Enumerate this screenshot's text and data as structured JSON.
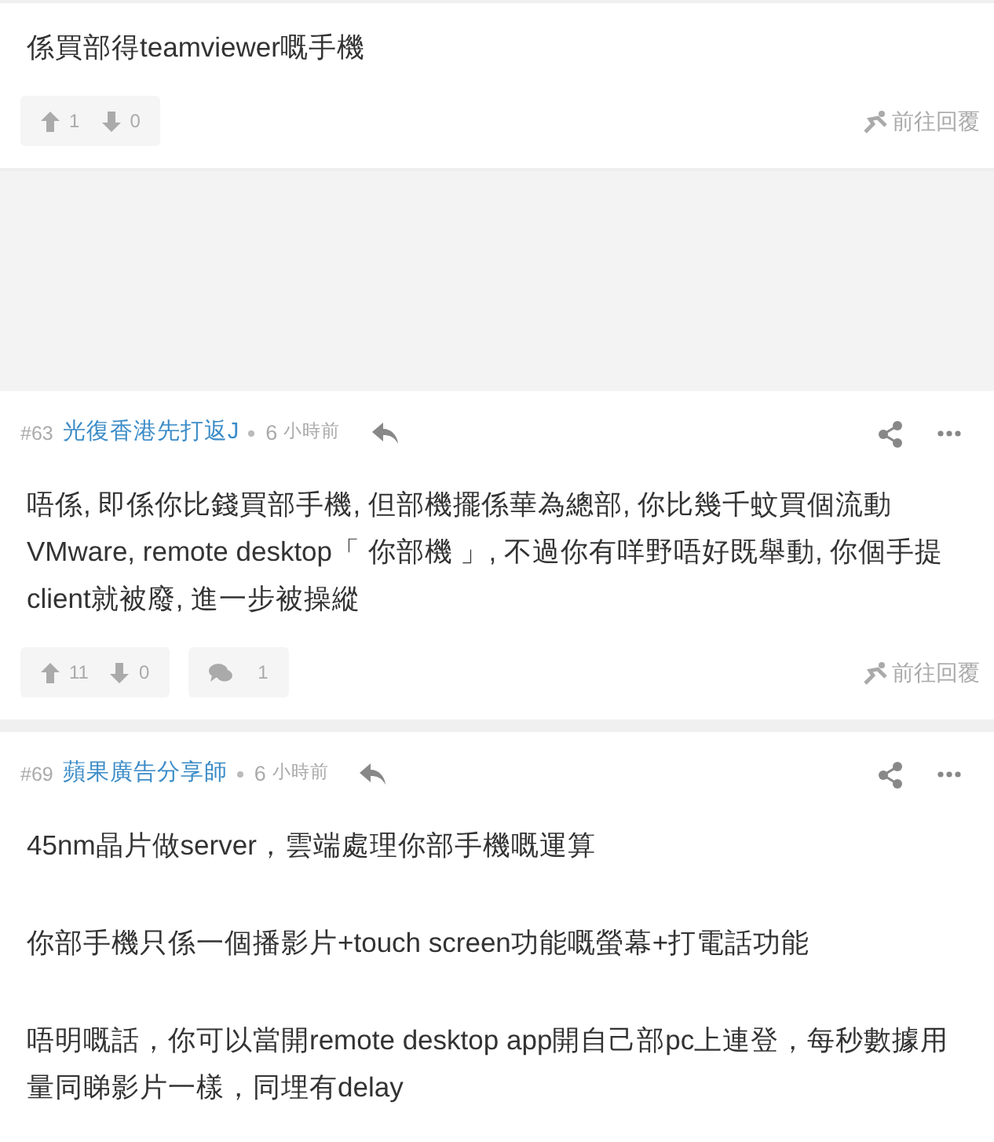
{
  "posts": [
    {
      "kind": "partial",
      "paragraphs": [
        "係買部得teamviewer嘅手機"
      ],
      "upvotes": "1",
      "downvotes": "0",
      "reply_link": "前往回覆"
    },
    {
      "kind": "full",
      "number": "#63",
      "author": "光復香港先打返J",
      "age": "6",
      "age_unit": "小時前",
      "paragraphs": [
        "唔係, 即係你比錢買部手機, 但部機擺係華為總部, 你比幾千蚊買個流動VMware, remote desktop「 你部機 」, 不過你有咩野唔好既舉動, 你個手提client就被廢, 進一步被操縱"
      ],
      "upvotes": "11",
      "downvotes": "0",
      "comments": "1",
      "reply_link": "前往回覆"
    },
    {
      "kind": "full",
      "number": "#69",
      "author": "蘋果廣告分享師",
      "age": "6",
      "age_unit": "小時前",
      "paragraphs": [
        "45nm晶片做server，雲端處理你部手機嘅運算",
        "你部手機只係一個播影片+touch screen功能嘅螢幕+打電話功能",
        "唔明嘅話，你可以當開remote desktop app開自己部pc上連登，每秒數據用量同睇影片一樣，同埋有delay"
      ]
    }
  ]
}
